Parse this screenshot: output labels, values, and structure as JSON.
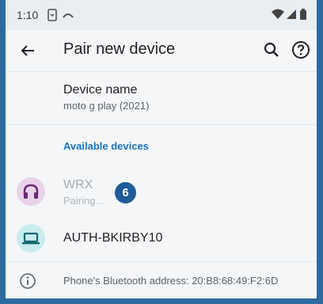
{
  "status": {
    "time": "1:10"
  },
  "toolbar": {
    "title": "Pair new device"
  },
  "device_name": {
    "label": "Device name",
    "value": "moto g play (2021)"
  },
  "available": {
    "header": "Available devices"
  },
  "devices": [
    {
      "name": "WRX",
      "status": "Pairing…",
      "icon": "headphones-icon"
    },
    {
      "name": "AUTH-BKIRBY10",
      "icon": "laptop-icon"
    }
  ],
  "badge": {
    "count": "6"
  },
  "info": {
    "text": "Phone's Bluetooth address: 20:B8:68:49:F2:6D"
  },
  "colors": {
    "accent": "#1a73b8",
    "badge": "#1f5c99",
    "frame": "#2c6aa0"
  }
}
